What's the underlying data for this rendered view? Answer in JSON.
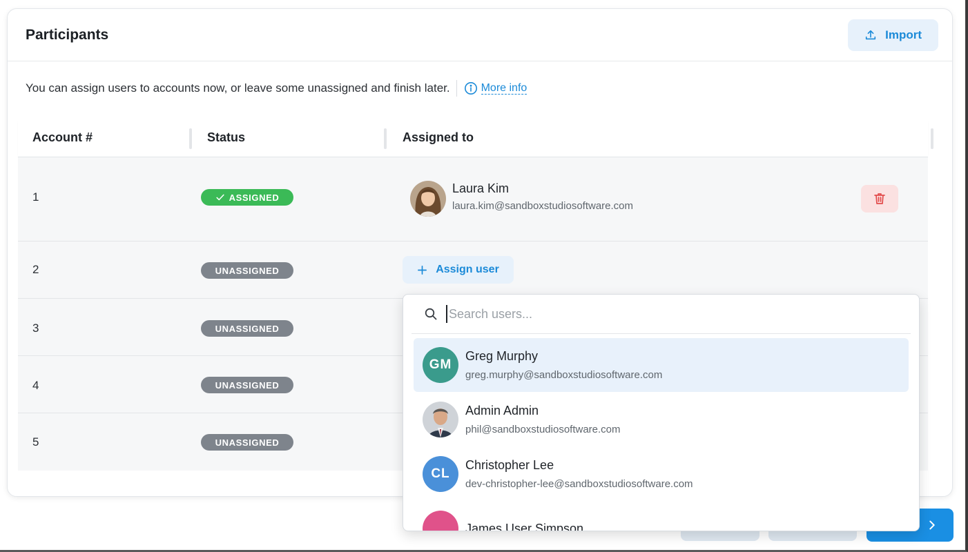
{
  "header": {
    "title": "Participants",
    "import_label": "Import"
  },
  "intro": {
    "text": "You can assign users to accounts now, or leave some unassigned and finish later.",
    "more_info": "More info"
  },
  "table": {
    "columns": [
      "Account #",
      "Status",
      "Assigned to"
    ],
    "rows": [
      {
        "num": "1",
        "status": "ASSIGNED",
        "user": {
          "name": "Laura Kim",
          "email": "laura.kim@sandboxstudiosoftware.com"
        }
      },
      {
        "num": "2",
        "status": "UNASSIGNED",
        "assign_label": "Assign user"
      },
      {
        "num": "3",
        "status": "UNASSIGNED"
      },
      {
        "num": "4",
        "status": "UNASSIGNED"
      },
      {
        "num": "5",
        "status": "UNASSIGNED"
      }
    ]
  },
  "dropdown": {
    "search_placeholder": "Search users...",
    "options": [
      {
        "initials": "GM",
        "name": "Greg Murphy",
        "email": "greg.murphy@sandboxstudiosoftware.com",
        "color": "#3a9b8c"
      },
      {
        "initials": "",
        "name": "Admin Admin",
        "email": "phil@sandboxstudiosoftware.com",
        "color": "#6b7079"
      },
      {
        "initials": "CL",
        "name": "Christopher Lee",
        "email": "dev-christopher-lee@sandboxstudiosoftware.com",
        "color": "#4a90d9"
      },
      {
        "initials": "",
        "name": "James User Simpson",
        "email": "",
        "color": "#e0528a"
      }
    ]
  },
  "colors": {
    "accent": "#1b8ad8",
    "assigned": "#3bba57",
    "unassigned": "#7e848c",
    "danger": "#e24c4c"
  }
}
